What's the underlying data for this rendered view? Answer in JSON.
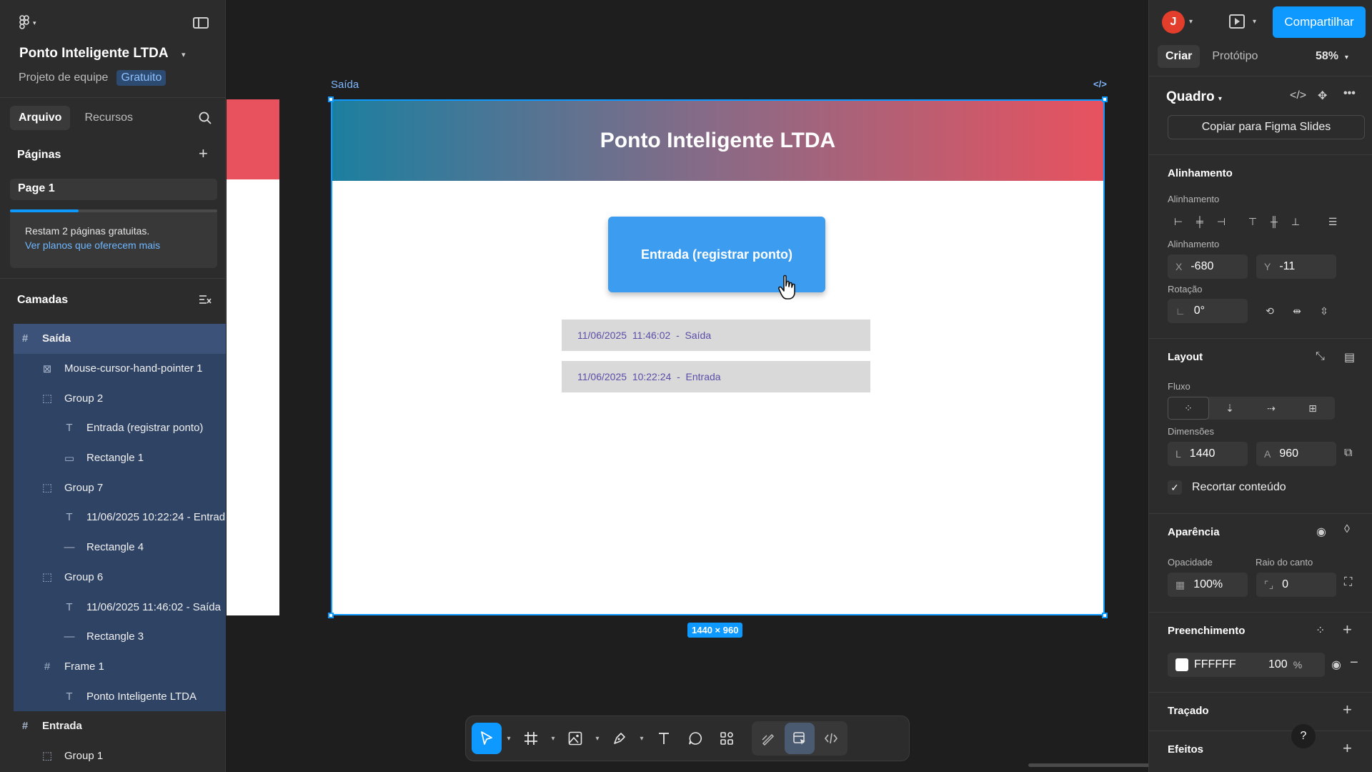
{
  "app": {
    "project_title": "Ponto Inteligente LTDA",
    "project_team": "Projeto de equipe",
    "plan_badge": "Gratuito",
    "accent_color": "#0d99ff"
  },
  "left_panel": {
    "tabs": [
      "Arquivo",
      "Recursos"
    ],
    "pages_title": "Páginas",
    "pages": [
      "Page 1"
    ],
    "promo": {
      "text": "Restam 2 páginas gratuitas.",
      "link": "Ver planos que oferecem mais",
      "progress": 0.33
    },
    "layers_title": "Camadas",
    "layers": [
      {
        "label": "Saída",
        "icon": "frame-icon",
        "level": 0
      },
      {
        "label": "Mouse-cursor-hand-pointer 1",
        "icon": "image-icon",
        "level": 1
      },
      {
        "label": "Group 2",
        "icon": "group-icon",
        "level": 1
      },
      {
        "label": "Entrada (registrar ponto)",
        "icon": "text-icon",
        "level": 2
      },
      {
        "label": "Rectangle 1",
        "icon": "rectangle-icon",
        "level": 2
      },
      {
        "label": "Group 7",
        "icon": "group-icon",
        "level": 1
      },
      {
        "label": "11/06/2025 10:22:24 - Entrad",
        "icon": "text-icon",
        "level": 2
      },
      {
        "label": "Rectangle 4",
        "icon": "line-icon",
        "level": 2
      },
      {
        "label": "Group 6",
        "icon": "group-icon",
        "level": 1
      },
      {
        "label": "11/06/2025 11:46:02 - Saída",
        "icon": "text-icon",
        "level": 2
      },
      {
        "label": "Rectangle 3",
        "icon": "line-icon",
        "level": 2
      },
      {
        "label": "Frame 1",
        "icon": "frame-icon",
        "level": 1
      },
      {
        "label": "Ponto Inteligente LTDA",
        "icon": "text-icon",
        "level": 2
      },
      {
        "label": "Entrada",
        "icon": "frame-icon",
        "level": 0
      },
      {
        "label": "Group 1",
        "icon": "group-icon",
        "level": 1
      }
    ]
  },
  "canvas": {
    "frame_label": "Saída",
    "code_mark": "</>",
    "frame_title": "Ponto Inteligente LTDA",
    "entry_button": "Entrada (registrar ponto)",
    "records": [
      {
        "date": "11/06/2025",
        "time": "11:46:02",
        "sep": "-",
        "type": "Saída"
      },
      {
        "date": "11/06/2025",
        "time": "10:22:24",
        "sep": "-",
        "type": "Entrada"
      }
    ],
    "size_badge": "1440 × 960",
    "header_gradient": [
      "#1c7fa0",
      "#e8525f"
    ],
    "button_color": "#3b9cf0"
  },
  "right_panel": {
    "avatar_initial": "J",
    "share_label": "Compartilhar",
    "tabs": [
      "Criar",
      "Protótipo"
    ],
    "zoom": "58%",
    "element_type": "Quadro",
    "copy_button": "Copiar para Figma Slides",
    "alignment_title": "Alinhamento",
    "alignment_label": "Alinhamento",
    "position_label": "Alinhamento",
    "x_prefix": "X",
    "x_value": "-680",
    "y_prefix": "Y",
    "y_value": "-11",
    "rotation_label": "Rotação",
    "rotation_value": "0°",
    "layout_title": "Layout",
    "flow_label": "Fluxo",
    "dimensions_label": "Dimensões",
    "w_prefix": "L",
    "w_value": "1440",
    "h_prefix": "A",
    "h_value": "960",
    "clip_label": "Recortar conteúdo",
    "appearance_title": "Aparência",
    "opacity_label": "Opacidade",
    "opacity_value": "100%",
    "radius_label": "Raio do canto",
    "radius_value": "0",
    "fill_title": "Preenchimento",
    "fill_hex": "FFFFFF",
    "fill_opacity": "100",
    "fill_unit": "%",
    "stroke_title": "Traçado",
    "effects_title": "Efeitos",
    "help": "?"
  }
}
